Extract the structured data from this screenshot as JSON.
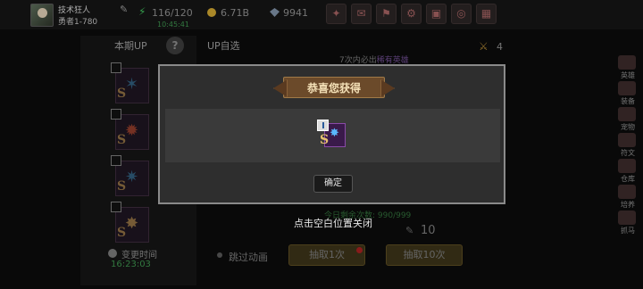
{
  "player": {
    "name": "技术狂人",
    "level": "勇者1-780"
  },
  "resources": {
    "stamina": "116/120",
    "stamina_timer": "10:45:41",
    "gold": "6.71B",
    "gems": "9941"
  },
  "top_icons": [
    "gift-icon",
    "mail-icon",
    "flag-icon",
    "settings-icon",
    "chest-icon",
    "wheel-icon",
    "calendar-icon"
  ],
  "tabs": {
    "current": "本期UP",
    "self_select": "UP自选"
  },
  "draw_count": "4",
  "promo": {
    "prefix": "7次内必出",
    "highlight": "稀有英雄"
  },
  "hero_ranks": [
    "S",
    "S",
    "S",
    "S"
  ],
  "change_time": {
    "label": "变更时间",
    "time": "16:23:03"
  },
  "today_count": "今日剩余次数: 990/999",
  "skip_label": "跳过动画",
  "ticket_count": "10",
  "buttons": {
    "draw1": "抽取1次",
    "draw10": "抽取10次"
  },
  "sidebar": [
    "英雄",
    "装备",
    "宠物",
    "符文",
    "仓库",
    "培养",
    "抓马"
  ],
  "dialog": {
    "title": "恭喜您获得",
    "reward_rank": "S",
    "confirm": "确定",
    "close_hint": "点击空白位置关闭"
  },
  "colors": {
    "accent_green": "#3b8d4b",
    "banner": "#6b4a2a",
    "reward_frame": "#8a4aa8"
  }
}
